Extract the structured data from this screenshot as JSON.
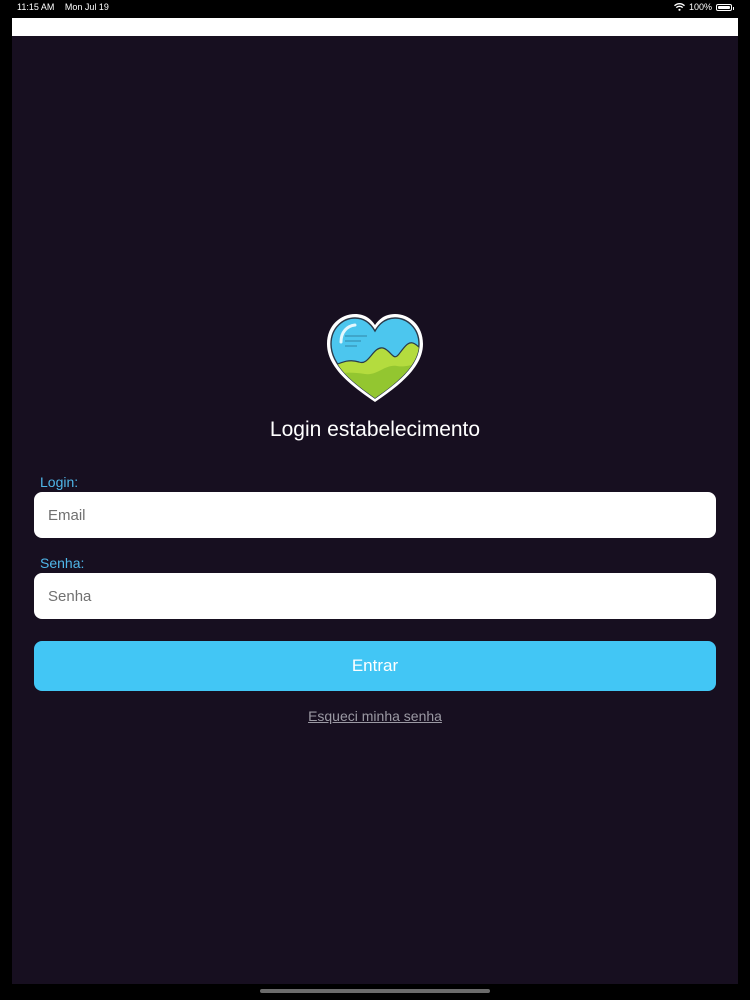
{
  "status_bar": {
    "time": "11:15 AM",
    "date": "Mon Jul 19",
    "battery": "100%",
    "icons": [
      "wifi-icon",
      "battery-icon"
    ]
  },
  "login": {
    "title": "Login estabelecimento",
    "logo_icon": "heart-landscape-logo",
    "login_label": "Login:",
    "email_placeholder": "Email",
    "password_label": "Senha:",
    "password_placeholder": "Senha",
    "submit_label": "Entrar",
    "forgot_label": "Esqueci minha senha"
  },
  "colors": {
    "background": "#170f20",
    "accent": "#42c6f5",
    "label": "#4fb6e8",
    "link": "#9b99a3"
  }
}
